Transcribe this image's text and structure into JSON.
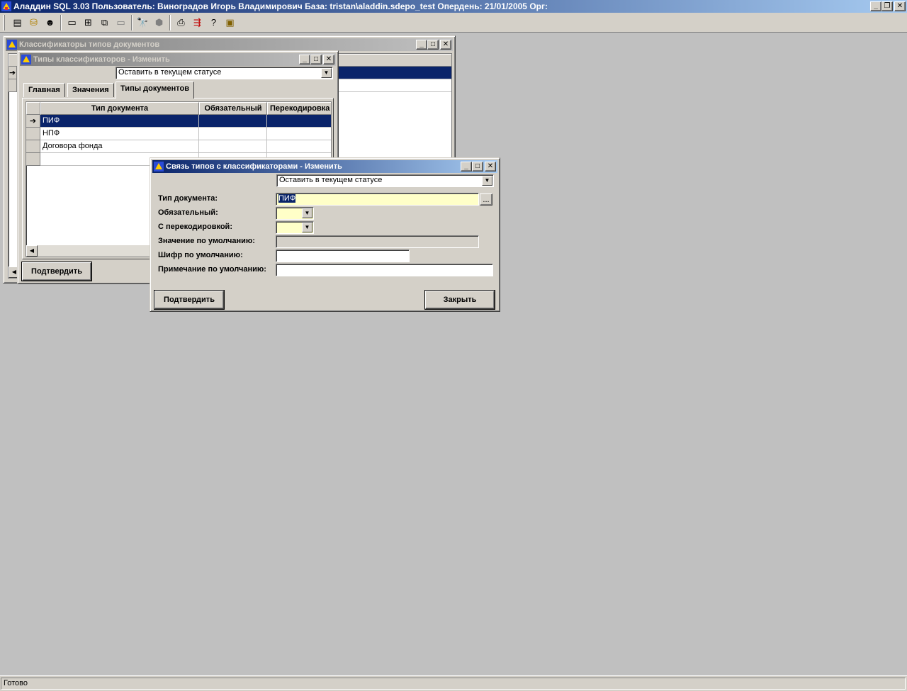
{
  "app": {
    "title": "Аладдин SQL 3.03 Пользователь: Виноградов Игорь Владимирович База: tristan\\aladdin.sdepo_test Опердень: 21/01/2005 Орг:"
  },
  "toolbar": {
    "icons": [
      "list-icon",
      "database-icon",
      "users-icon",
      "window-icon",
      "tile-icon",
      "cascade-icon",
      "blank-window-icon",
      "binoculars-icon",
      "stop-icon",
      "print-icon",
      "export-icon",
      "help-icon",
      "exit-icon"
    ]
  },
  "win_classifiers": {
    "title": "Классификаторы типов документов"
  },
  "win_types": {
    "title": "Типы классификаторов - Изменить",
    "status_combo": "Оставить в текущем статусе",
    "tabs": [
      "Главная",
      "Значения",
      "Типы документов"
    ],
    "grid": {
      "headers": [
        "Тип документа",
        "Обязательный",
        "Перекодировка"
      ],
      "rows": [
        {
          "doc_type": "ПИФ",
          "required": "",
          "recode": ""
        },
        {
          "doc_type": "НПФ",
          "required": "",
          "recode": ""
        },
        {
          "doc_type": "Договора фонда",
          "required": "",
          "recode": ""
        },
        {
          "doc_type": "",
          "required": "",
          "recode": ""
        }
      ]
    },
    "confirm_label": "Подтвердить"
  },
  "win_link": {
    "title": "Связь типов с классификаторами - Изменить",
    "status_combo": "Оставить в текущем статусе",
    "labels": {
      "doc_type": "Тип документа:",
      "required": "Обязательный:",
      "recode": "С перекодировкой:",
      "default_value": "Значение по умолчанию:",
      "default_code": "Шифр по умолчанию:",
      "default_note": "Примечание по умолчанию:"
    },
    "values": {
      "doc_type": "ПИФ",
      "required": "",
      "recode": "",
      "default_value": "",
      "default_code": "",
      "default_note": ""
    },
    "browse_label": "...",
    "confirm_label": "Подтвердить",
    "close_label": "Закрыть"
  },
  "status": {
    "text": "Готово"
  }
}
